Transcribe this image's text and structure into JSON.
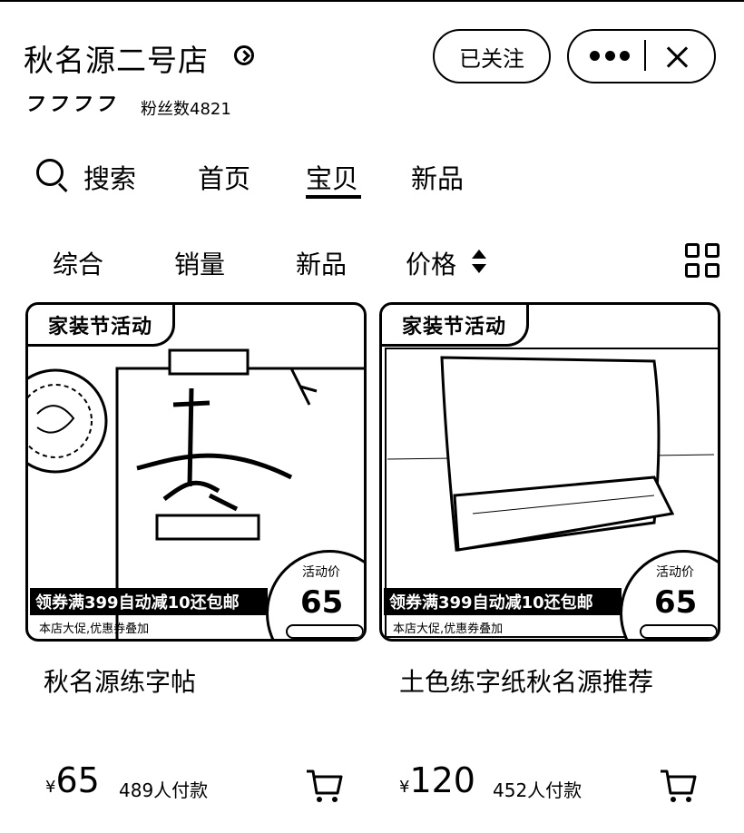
{
  "shop": {
    "name": "秋名源二号店",
    "rating_glyphs": [
      "フ",
      "フ",
      "フ",
      "フ"
    ],
    "fans": "粉丝数4821"
  },
  "header": {
    "follow_label": "已关注",
    "icons": [
      "more-icon",
      "close-icon",
      "chevron-right-circle-icon"
    ]
  },
  "nav": {
    "search_label": "搜索",
    "tabs": [
      {
        "label": "首页",
        "active": false
      },
      {
        "label": "宝贝",
        "active": true
      },
      {
        "label": "新品",
        "active": false
      }
    ]
  },
  "sort": {
    "items": [
      {
        "label": "综合"
      },
      {
        "label": "销量"
      },
      {
        "label": "新品"
      },
      {
        "label": "价格"
      }
    ]
  },
  "products": [
    {
      "badge": "家装节活动",
      "promo": "领券满399自动减10还包邮",
      "subpromo": "本店大促,优惠券叠加",
      "price_label": "活动价",
      "price_tag": "65",
      "title": "秋名源练字帖",
      "yen": "¥",
      "price": "65",
      "paid": "489人付款"
    },
    {
      "badge": "家装节活动",
      "promo": "领券满399自动减10还包邮",
      "subpromo": "本店大促,优惠券叠加",
      "price_label": "活动价",
      "price_tag": "65",
      "title": "土色练字纸秋名源推荐",
      "yen": "¥",
      "price": "120",
      "paid": "452人付款"
    }
  ]
}
